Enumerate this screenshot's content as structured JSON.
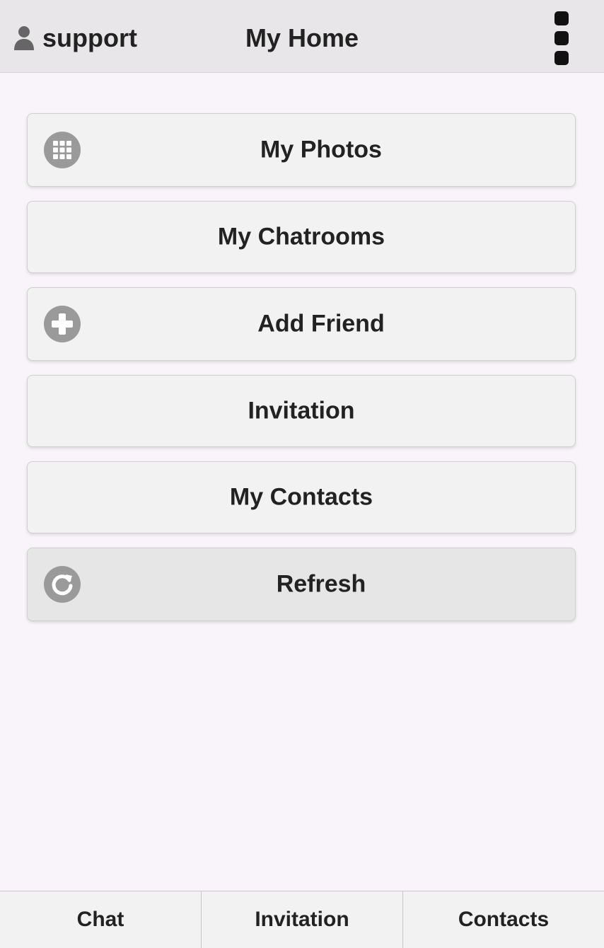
{
  "header": {
    "username": "support",
    "title": "My Home",
    "user_icon": "user-icon",
    "menu_icon": "overflow-menu-icon"
  },
  "menu": {
    "items": [
      {
        "label": "My Photos",
        "icon": "grid-icon"
      },
      {
        "label": "My Chatrooms",
        "icon": ""
      },
      {
        "label": "Add Friend",
        "icon": "plus-circle-icon"
      },
      {
        "label": "Invitation",
        "icon": ""
      },
      {
        "label": "My Contacts",
        "icon": ""
      },
      {
        "label": "Refresh",
        "icon": "refresh-icon"
      }
    ]
  },
  "tabs": [
    {
      "label": "Chat"
    },
    {
      "label": "Invitation"
    },
    {
      "label": "Contacts"
    }
  ],
  "colors": {
    "background": "#f8f4f9",
    "header": "#e9e6e9",
    "button": "#f2f2f2",
    "icon": "#9a9a9a"
  }
}
